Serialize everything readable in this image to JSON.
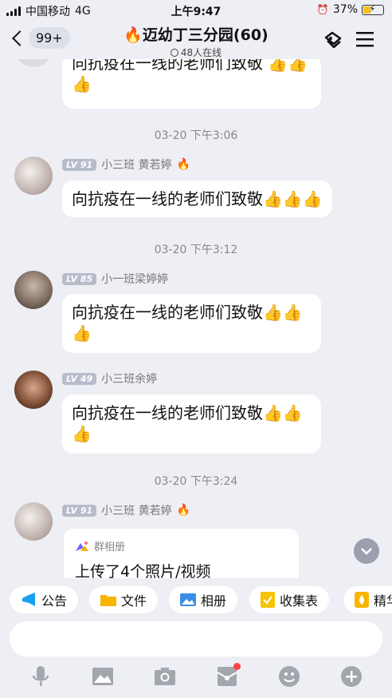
{
  "status": {
    "carrier": "中国移动",
    "network": "4G",
    "time": "上午9:47",
    "battery": "37%",
    "battery_level": 0.37
  },
  "header": {
    "back_count": "99+",
    "title": "迈幼丁三分园(60)",
    "online": "48人在线"
  },
  "messages": [
    {
      "text": "向抗疫在一线的老师们致敬",
      "thumbs": 3
    },
    {
      "timestamp": "03-20 下午3:06",
      "level": "LV 91",
      "sender": "小三班 黄若婷",
      "text": "向抗疫在一线的老师们致敬",
      "thumbs": 3
    },
    {
      "timestamp": "03-20 下午3:12",
      "level": "LV 85",
      "sender": "小一班梁婷婷",
      "text": "向抗疫在一线的老师们致敬",
      "thumbs": 3
    },
    {
      "level": "LV 49",
      "sender": "小三班余婷",
      "text": "向抗疫在一线的老师们致敬",
      "thumbs": 3
    },
    {
      "timestamp": "03-20 下午3:24",
      "level": "LV 91",
      "sender": "小三班 黄若婷",
      "album_label": "群相册",
      "album_text": "上传了4个照片/视频"
    }
  ],
  "quick_actions": [
    {
      "label": "公告",
      "icon": "megaphone-icon",
      "color": "#1aa0f0"
    },
    {
      "label": "文件",
      "icon": "folder-icon",
      "color": "#f7b500"
    },
    {
      "label": "相册",
      "icon": "picture-icon",
      "color": "#3a8ee6"
    },
    {
      "label": "收集表",
      "icon": "form-icon",
      "color": "#f7c300"
    },
    {
      "label": "精华",
      "icon": "essence-icon",
      "color": "#f7b500"
    }
  ],
  "toolbar": [
    "microphone-icon",
    "image-icon",
    "camera-icon",
    "red-packet-icon",
    "emoji-icon",
    "plus-icon"
  ],
  "colors": {
    "accent": "#f44336",
    "level_badge": "#b7bccb",
    "background": "#eeeff4"
  }
}
